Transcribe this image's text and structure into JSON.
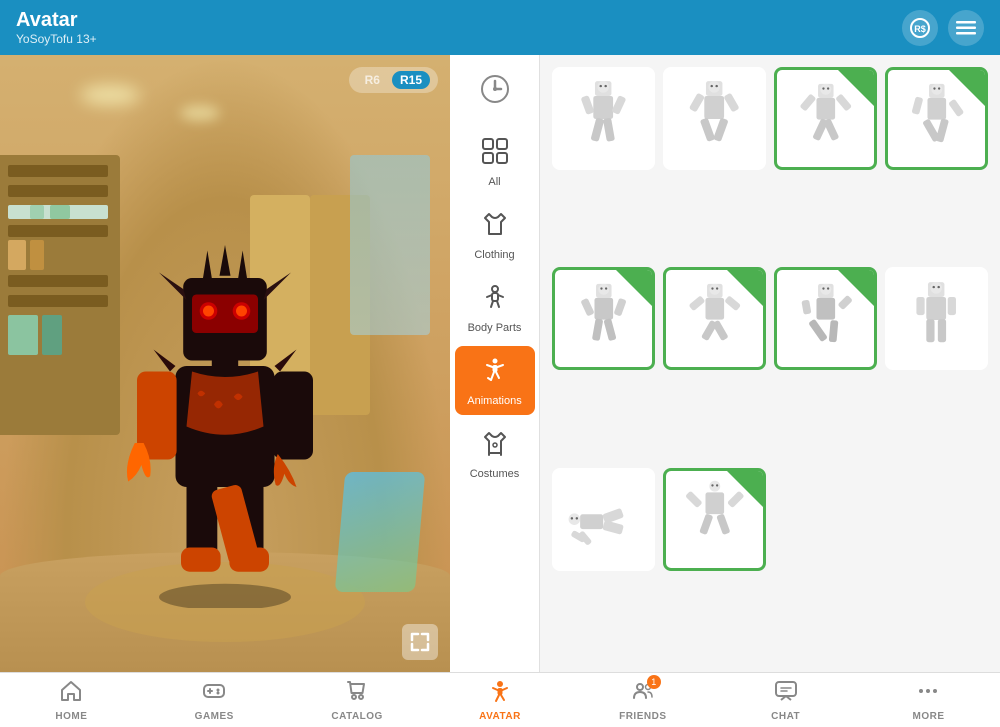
{
  "header": {
    "title": "Avatar",
    "subtitle": "YoSoyTofu 13+",
    "robux_icon": "RS",
    "menu_icon": "≡"
  },
  "rating_toggle": {
    "r6": "R6",
    "r15": "R15"
  },
  "sidebar": {
    "items": [
      {
        "id": "recent",
        "label": "Recent",
        "icon": "🕐"
      },
      {
        "id": "all",
        "label": "All",
        "icon": "⊞"
      },
      {
        "id": "clothing",
        "label": "Clothing",
        "icon": "👕"
      },
      {
        "id": "body-parts",
        "label": "Body Parts",
        "icon": "🦺"
      },
      {
        "id": "animations",
        "label": "Animations",
        "icon": "🏃"
      },
      {
        "id": "costumes",
        "label": "Costumes",
        "icon": "🎭"
      }
    ]
  },
  "grid": {
    "items": [
      {
        "id": 1,
        "selected": false
      },
      {
        "id": 2,
        "selected": false
      },
      {
        "id": 3,
        "selected": true
      },
      {
        "id": 4,
        "selected": true
      },
      {
        "id": 5,
        "selected": true
      },
      {
        "id": 6,
        "selected": true
      },
      {
        "id": 7,
        "selected": true
      },
      {
        "id": 8,
        "selected": false
      },
      {
        "id": 9,
        "selected": false
      },
      {
        "id": 10,
        "selected": true
      }
    ]
  },
  "bottom_nav": {
    "items": [
      {
        "id": "home",
        "label": "HOME",
        "icon": "🏠",
        "active": false
      },
      {
        "id": "games",
        "label": "GAMES",
        "icon": "🎮",
        "active": false
      },
      {
        "id": "catalog",
        "label": "CATALOG",
        "icon": "🛒",
        "active": false
      },
      {
        "id": "avatar",
        "label": "AVATAR",
        "icon": "🏃",
        "active": true
      },
      {
        "id": "friends",
        "label": "FRIENDS",
        "icon": "👥",
        "active": false,
        "badge": "1"
      },
      {
        "id": "chat",
        "label": "CHAT",
        "icon": "💬",
        "active": false
      },
      {
        "id": "more",
        "label": "MORE",
        "icon": "···",
        "active": false
      }
    ]
  }
}
